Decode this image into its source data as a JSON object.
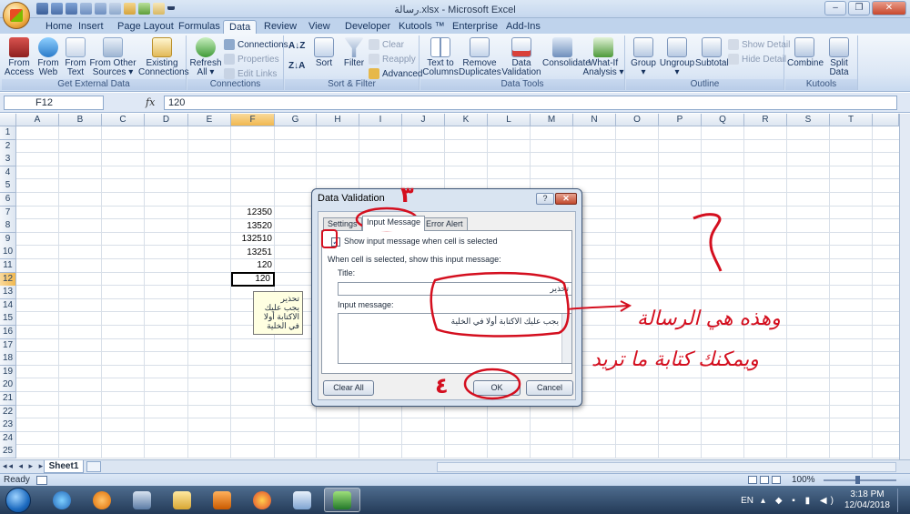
{
  "window": {
    "title": "رسالة.xlsx - Microsoft Excel",
    "minimize": "–",
    "restore": "❐",
    "close": "✕"
  },
  "ribbon_tabs": [
    "Home",
    "Insert",
    "Page Layout",
    "Formulas",
    "Data",
    "Review",
    "View",
    "Developer",
    "Kutools ™",
    "Enterprise",
    "Add-Ins"
  ],
  "active_tab": "Data",
  "ribbon_help": [
    "?",
    "–",
    "❐",
    "✕"
  ],
  "groups": {
    "get_external": {
      "label": "Get External Data",
      "buttons": [
        "From Access",
        "From Web",
        "From Text",
        "From Other Sources ▾",
        "Existing Connections"
      ]
    },
    "connections": {
      "label": "Connections",
      "refresh": "Refresh All ▾",
      "connections": "Connections",
      "properties": "Properties",
      "edit_links": "Edit Links"
    },
    "sort_filter": {
      "label": "Sort & Filter",
      "sort": "Sort",
      "filter": "Filter",
      "clear": "Clear",
      "reapply": "Reapply",
      "advanced": "Advanced"
    },
    "data_tools": {
      "label": "Data Tools",
      "buttons": [
        "Text to Columns",
        "Remove Duplicates",
        "Data Validation ▾",
        "Consolidate",
        "What-If Analysis ▾"
      ]
    },
    "outline": {
      "label": "Outline",
      "buttons": [
        "Group ▾",
        "Ungroup ▾",
        "Subtotal"
      ],
      "show_detail": "Show Detail",
      "hide_detail": "Hide Detail"
    },
    "kutools": {
      "label": "Kutools",
      "buttons": [
        "Combine",
        "Split Data"
      ]
    }
  },
  "formula_bar": {
    "name_box": "F12",
    "fx": "fx",
    "value": "120"
  },
  "columns": [
    "A",
    "B",
    "C",
    "D",
    "E",
    "F",
    "G",
    "H",
    "I",
    "J",
    "K",
    "L",
    "M",
    "N",
    "O",
    "P",
    "Q",
    "R",
    "S",
    "T"
  ],
  "rows": [
    "1",
    "2",
    "3",
    "4",
    "5",
    "6",
    "7",
    "8",
    "9",
    "10",
    "11",
    "12",
    "13",
    "14",
    "15",
    "16",
    "17",
    "18",
    "19",
    "20",
    "21",
    "22",
    "23",
    "24",
    "25"
  ],
  "cells": [
    {
      "row": 7,
      "value": "12350"
    },
    {
      "row": 8,
      "value": "13520"
    },
    {
      "row": 9,
      "value": "132510"
    },
    {
      "row": 10,
      "value": "13251"
    },
    {
      "row": 11,
      "value": "120"
    },
    {
      "row": 12,
      "value": "120"
    }
  ],
  "cell_tooltip": {
    "title": "تحذير",
    "message": "يجب عليك الاكتابة أولا في الخلية"
  },
  "sheet": {
    "nav": "◂◂ ◂ ▸ ▸▸",
    "tab": "Sheet1"
  },
  "status": {
    "ready": "Ready",
    "zoom": "100%",
    "zoom_minus": "–",
    "zoom_plus": "+"
  },
  "taskbar": {
    "lang": "EN",
    "time": "3:18 PM",
    "date": "12/04/2018"
  },
  "dialog": {
    "title": "Data Validation",
    "help": "?",
    "close": "✕",
    "tabs": [
      "Settings",
      "Input Message",
      "Error Alert"
    ],
    "active_tab": "Input Message",
    "checkbox_checked": true,
    "checkbox_label": "Show input message when cell is selected",
    "section_label": "When cell is selected, show this input message:",
    "title_label": "Title:",
    "title_value": "تحذير",
    "message_label": "Input message:",
    "message_value": "يجب عليك الاكتابة أولا في الخلية",
    "clear_all": "Clear All",
    "ok": "OK",
    "cancel": "Cancel"
  },
  "annotations": {
    "step2": "٢",
    "step3": "٣",
    "step4": "٤",
    "note_line1": "وهذه هي الرسالة",
    "note_line2": "ويمكنك كتابة ما تريد",
    "color": "#d40f1f"
  }
}
